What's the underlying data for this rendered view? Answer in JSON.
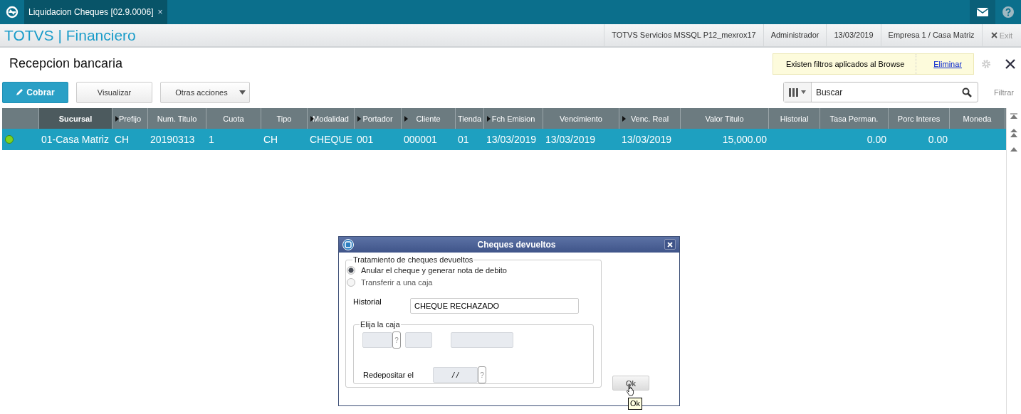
{
  "topbar": {
    "tab": {
      "label": "Liquidacion Cheques [02.9.0006]",
      "close": "×",
      "selected": true
    }
  },
  "header": {
    "brand": "TOTVS | Financiero",
    "info": [
      "TOTVS Servicios MSSQL P12_mexrox17",
      "Administrador",
      "13/03/2019",
      "Empresa 1 / Casa Matriz"
    ],
    "exit": "Exit"
  },
  "page": {
    "title": "Recepcion bancaria",
    "filter_notice": "Existen filtros aplicados al Browse",
    "filter_link": "Eliminar"
  },
  "toolbar": {
    "buttons": [
      {
        "label": "Cobrar",
        "kind": "primary"
      },
      {
        "label": "Visualizar",
        "kind": "plain"
      },
      {
        "label": "Otras acciones",
        "kind": "dropdown"
      }
    ],
    "search": {
      "placeholder": "Buscar"
    },
    "filter": "Filtrar"
  },
  "table": {
    "columns": [
      {
        "label": "Sucursal",
        "marker": false,
        "selected": true,
        "kind": "text"
      },
      {
        "label": "Prefijo",
        "marker": true,
        "selected": false,
        "kind": "text"
      },
      {
        "label": "Num. Titulo",
        "marker": false,
        "selected": false,
        "kind": "text"
      },
      {
        "label": "Cuota",
        "marker": false,
        "selected": false,
        "kind": "text"
      },
      {
        "label": "Tipo",
        "marker": false,
        "selected": false,
        "kind": "text"
      },
      {
        "label": "Modalidad",
        "marker": true,
        "selected": false,
        "kind": "text"
      },
      {
        "label": "Portador",
        "marker": true,
        "selected": false,
        "kind": "text"
      },
      {
        "label": "Cliente",
        "marker": true,
        "selected": false,
        "kind": "text"
      },
      {
        "label": "Tienda",
        "marker": false,
        "selected": false,
        "kind": "text"
      },
      {
        "label": "Fch Emision",
        "marker": true,
        "selected": false,
        "kind": "text"
      },
      {
        "label": "Vencimiento",
        "marker": false,
        "selected": false,
        "kind": "text"
      },
      {
        "label": "Venc. Real",
        "marker": true,
        "selected": false,
        "kind": "text"
      },
      {
        "label": "Valor Titulo",
        "marker": false,
        "selected": false,
        "kind": "number"
      },
      {
        "label": "Historial",
        "marker": false,
        "selected": false,
        "kind": "text"
      },
      {
        "label": "Tasa Perman.",
        "marker": false,
        "selected": false,
        "kind": "number"
      },
      {
        "label": "Porc Interes",
        "marker": false,
        "selected": false,
        "kind": "number"
      },
      {
        "label": "Moneda",
        "marker": false,
        "selected": false,
        "kind": "text"
      }
    ],
    "rows": [
      {
        "selected": true,
        "color": "#7ed321",
        "cells": [
          "01-Casa Matriz",
          "CH",
          "20190313",
          "1",
          "CH",
          "CHEQUE",
          "001",
          "000001",
          "01",
          "13/03/2019",
          "13/03/2019",
          "13/03/2019",
          "15,000.00",
          "",
          "0.00",
          "0.00",
          ""
        ]
      }
    ]
  },
  "dialog": {
    "title": "Cheques devueltos",
    "group": "Tratamiento de cheques devueltos",
    "options": [
      {
        "label": "Anular el cheque y generar nota de debito",
        "selected": true
      },
      {
        "label": "Transferir a una caja",
        "selected": false
      }
    ],
    "historial_label": "Historial",
    "historial_value": "CHEQUE RECHAZADO",
    "caja_group": "Elija la caja",
    "lookup": "?",
    "redeposit_label": "Redepositar el",
    "redeposit_value": " /  /",
    "ok": "Ok",
    "tooltip": "Ok"
  }
}
